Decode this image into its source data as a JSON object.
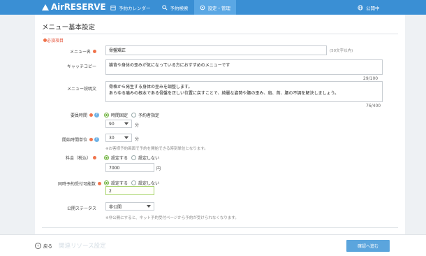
{
  "header": {
    "logo": "AirRESERVE",
    "nav": [
      {
        "label": "予約カレンダー",
        "icon": "calendar-icon"
      },
      {
        "label": "予約検索",
        "icon": "search-icon"
      },
      {
        "label": "設定・管理",
        "icon": "gear-icon",
        "active": true
      }
    ],
    "public_label": "公開中"
  },
  "page": {
    "title": "メニュー基本設定",
    "required_note": "必須項目"
  },
  "form": {
    "menu_name": {
      "label": "メニュー名",
      "value": "骨盤矯正",
      "hint": "(50文字以内)"
    },
    "catch_copy": {
      "label": "キャッチコピー",
      "value": "猫背や身体の歪みが気になっている方におすすめのメニューです",
      "count": "29/100"
    },
    "description": {
      "label": "メニュー説明文",
      "value": "骨格から発生する身体の歪みを調整します。\nあらゆる痛みの根本である骨盤を正しい位置に戻すことで、綺麗な姿勢や腰の歪み、肩、首、腰の不調を解決しましょう。",
      "count": "76/400"
    },
    "duration": {
      "label": "要員時間",
      "options": [
        "時間固定",
        "予約者指定"
      ],
      "selected": 0,
      "value": "90",
      "unit": "分"
    },
    "interval": {
      "label": "開始時間単位",
      "value": "30",
      "unit": "分",
      "hint": "※お客様予約画面で予約を開始できる時刻単位となります。"
    },
    "price": {
      "label": "料金（税込）",
      "options": [
        "設定する",
        "設定しない"
      ],
      "selected": 0,
      "value": "7000",
      "unit": "円"
    },
    "concurrent": {
      "label": "同時予約受付可能数",
      "options": [
        "設定する",
        "設定しない"
      ],
      "selected": 0,
      "value": "2"
    },
    "status": {
      "label": "公開ステータス",
      "value": "非公開",
      "hint": "※非公開にすると、ネット予約受付ページから予約が受けられなくなります。"
    }
  },
  "footer": {
    "back_label": "戻る",
    "next_section": "関連リソース設定",
    "primary_label": "確認へ進む"
  }
}
